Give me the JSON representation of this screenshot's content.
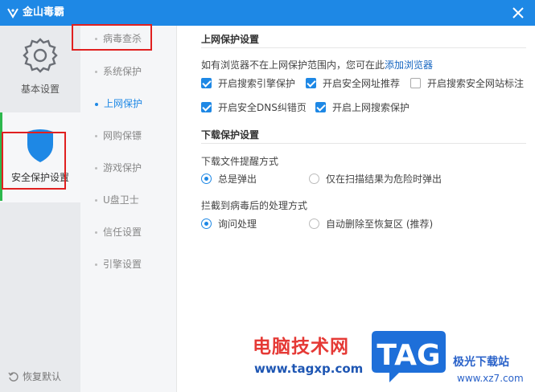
{
  "app": {
    "title": "金山毒霸"
  },
  "left_nav": {
    "basic": "基本设置",
    "security": "安全保护设置",
    "restore": "恢复默认"
  },
  "sub_nav": [
    {
      "label": "病毒查杀",
      "active": false
    },
    {
      "label": "系统保护",
      "active": false
    },
    {
      "label": "上网保护",
      "active": true
    },
    {
      "label": "网购保镖",
      "active": false
    },
    {
      "label": "游戏保护",
      "active": false
    },
    {
      "label": "U盘卫士",
      "active": false
    },
    {
      "label": "信任设置",
      "active": false
    },
    {
      "label": "引擎设置",
      "active": false
    }
  ],
  "web_protect": {
    "title": "上网保护设置",
    "hint": "如有浏览器不在上网保护范围内，您可在此",
    "add_link": "添加浏览器",
    "options": [
      {
        "label": "开启搜索引擎保护",
        "checked": true
      },
      {
        "label": "开启安全网址推荐",
        "checked": true
      },
      {
        "label": "开启搜索安全网站标注",
        "checked": false
      },
      {
        "label": "开启安全DNS纠错页",
        "checked": true
      },
      {
        "label": "开启上网搜索保护",
        "checked": true
      }
    ]
  },
  "download_protect": {
    "title": "下载保护设置",
    "reminder_label": "下载文件提醒方式",
    "reminder_options": [
      {
        "label": "总是弹出",
        "selected": true
      },
      {
        "label": "仅在扫描结果为危险时弹出",
        "selected": false
      }
    ],
    "action_label": "拦截到病毒后的处理方式",
    "action_options": [
      {
        "label": "询问处理",
        "selected": true
      },
      {
        "label": "自动删除至恢复区 (推荐)",
        "selected": false
      }
    ]
  },
  "watermark": {
    "text": "电脑技术网",
    "url": "www.tagxp.com",
    "tag": "TAG",
    "right_text": "极光下载站",
    "right_url": "www.xz7.com"
  },
  "colors": {
    "accent": "#1e88e5",
    "highlight": "#e02020",
    "active_bar": "#2db84d"
  }
}
